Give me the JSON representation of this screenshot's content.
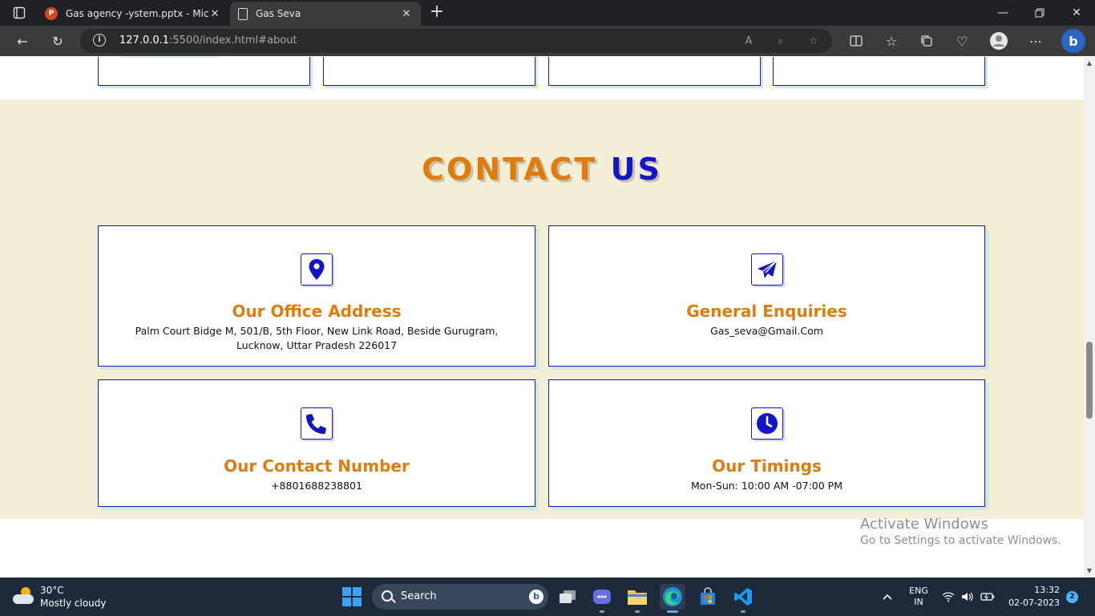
{
  "browser": {
    "tabs": [
      {
        "title": "Gas agency -ystem.pptx - Micros",
        "icon": "powerpoint-icon",
        "icon_text": "P"
      },
      {
        "title": "Gas Seva",
        "icon": "page-icon"
      }
    ],
    "url_host": "127.0.0.1",
    "url_rest": ":5500/index.html#about"
  },
  "contact": {
    "heading_word1": "CONTACT",
    "heading_word2": "US",
    "cards": [
      {
        "icon": "map-pin-icon",
        "title": "Our Office Address",
        "text": "Palm Court Bidge M, 501/B, 5th Floor, New Link Road, Beside Gurugram, Lucknow, Uttar Pradesh 226017"
      },
      {
        "icon": "paper-plane-icon",
        "title": "General Enquiries",
        "text": "Gas_seva@Gmail.Com"
      },
      {
        "icon": "phone-icon",
        "title": "Our Contact Number",
        "text": "+8801688238801"
      },
      {
        "icon": "clock-icon",
        "title": "Our Timings",
        "text": "Mon-Sun: 10:00 AM -07:00 PM"
      }
    ]
  },
  "watermark": {
    "title": "Activate Windows",
    "subtitle": "Go to Settings to activate Windows."
  },
  "taskbar": {
    "weather_temp": "30°C",
    "weather_desc": "Mostly cloudy",
    "search_label": "Search",
    "search_bing": "b",
    "lang_line1": "ENG",
    "lang_line2": "IN",
    "time": "13:32",
    "date": "02-07-2023",
    "notification_count": "2"
  },
  "colors": {
    "accent_orange": "#e07b10",
    "accent_blue": "#1515c8",
    "section_bg": "#f3eed6"
  }
}
